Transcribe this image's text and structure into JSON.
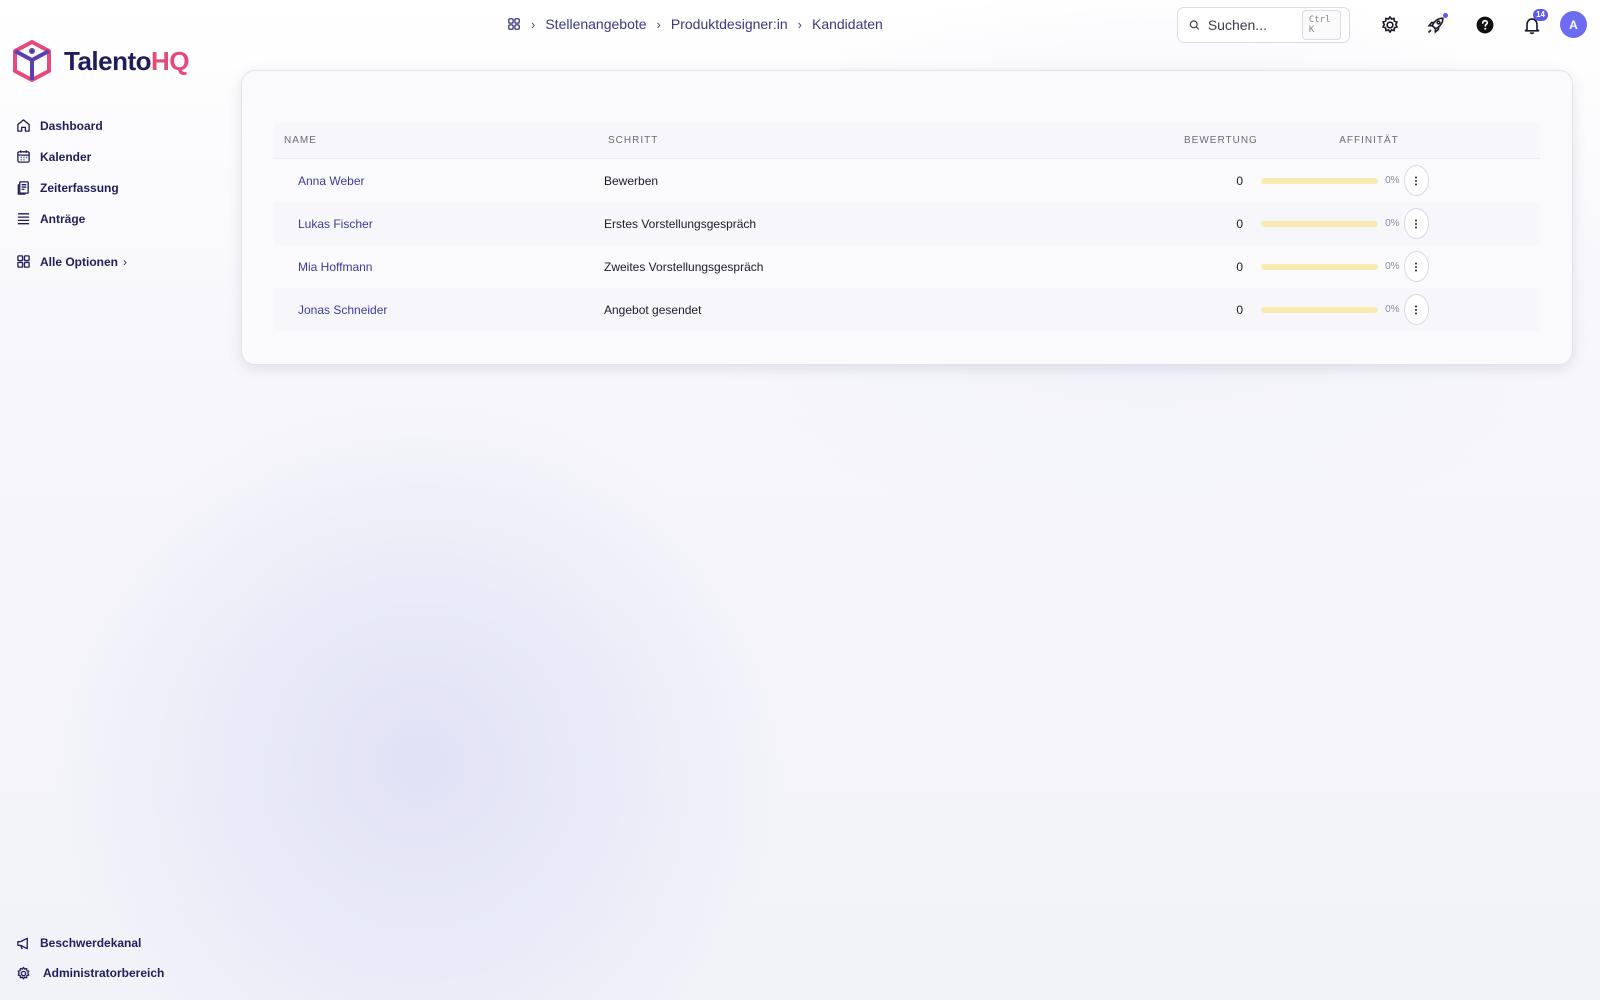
{
  "app": {
    "logo_word_main": "Talento",
    "logo_word_accent": "HQ",
    "accent_color": "#e54a7a",
    "brand_color": "#1f1d5c"
  },
  "sidebar": {
    "items": [
      {
        "label": "Dashboard",
        "icon": "home-icon"
      },
      {
        "label": "Kalender",
        "icon": "calendar-icon"
      },
      {
        "label": "Zeiterfassung",
        "icon": "clipboard-icon"
      },
      {
        "label": "Anträge",
        "icon": "list-icon"
      }
    ],
    "all_options_label": "Alle Optionen",
    "bottom_items": [
      {
        "label": "Beschwerdekanal",
        "icon": "megaphone-icon"
      },
      {
        "label": "Administratorbereich",
        "icon": "gear-icon"
      }
    ]
  },
  "breadcrumb": {
    "home_icon": "apps-grid-icon",
    "items": [
      "Stellenangebote",
      "Produktdesigner:in",
      "Kandidaten"
    ]
  },
  "search": {
    "placeholder": "Suchen...",
    "shortcut": "Ctrl K"
  },
  "topbar": {
    "notifications_count": "14",
    "avatar_initial": "A"
  },
  "table": {
    "headers": {
      "name": "NAME",
      "step": "SCHRITT",
      "score": "BEWERTUNG",
      "affinity": "AFFINITÄT"
    },
    "rows": [
      {
        "name": "Anna Weber",
        "step": "Bewerben",
        "score": "0",
        "affinity_label": "0%",
        "affinity": 0
      },
      {
        "name": "Lukas Fischer",
        "step": "Erstes Vorstellungsgespräch",
        "score": "0",
        "affinity_label": "0%",
        "affinity": 0
      },
      {
        "name": "Mia Hoffmann",
        "step": "Zweites Vorstellungsgespräch",
        "score": "0",
        "affinity_label": "0%",
        "affinity": 0
      },
      {
        "name": "Jonas Schneider",
        "step": "Angebot gesendet",
        "score": "0",
        "affinity_label": "0%",
        "affinity": 0
      }
    ]
  }
}
